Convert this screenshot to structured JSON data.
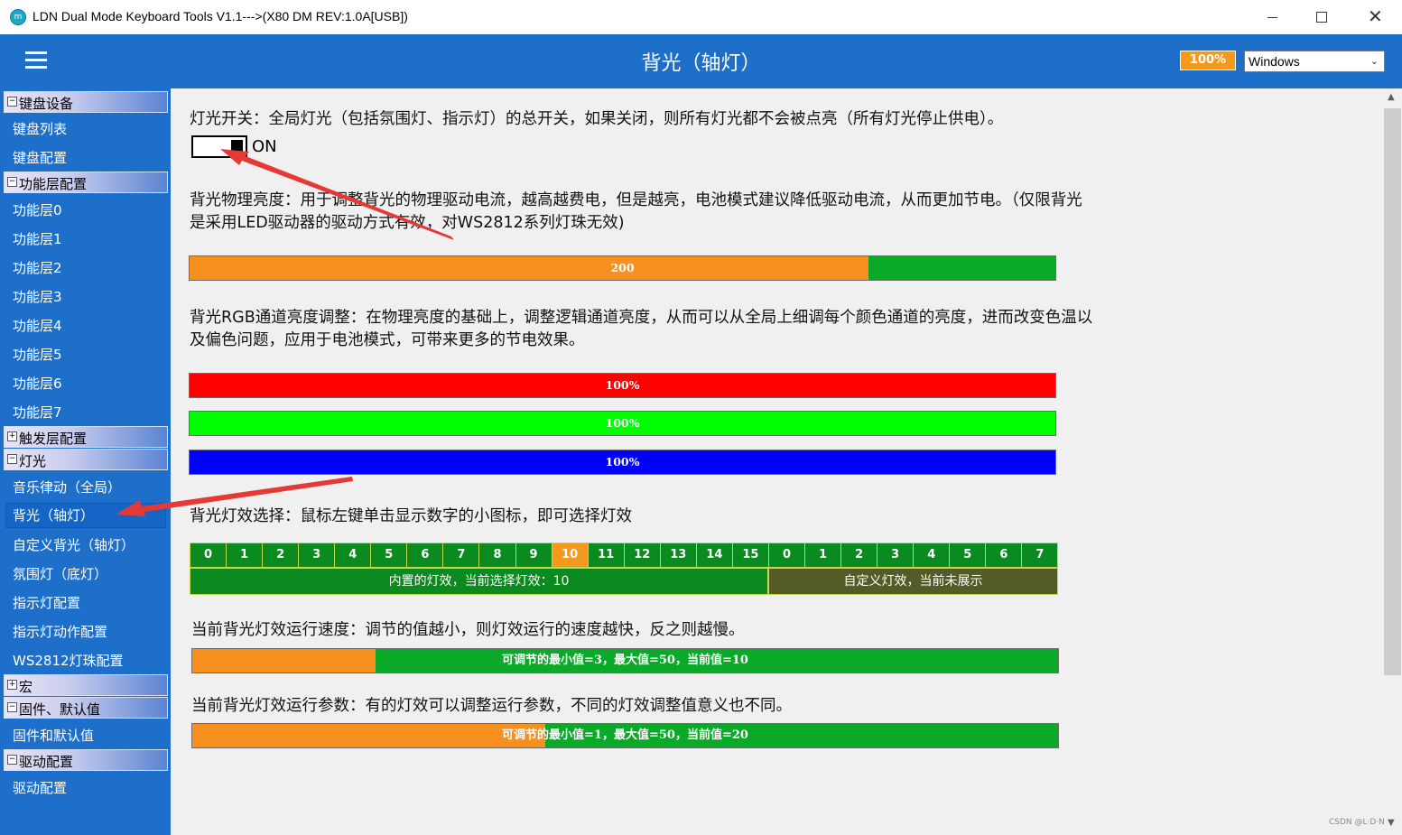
{
  "window": {
    "icon_text": "m",
    "title": "LDN Dual Mode Keyboard Tools V1.1--->(X80 DM REV:1.0A[USB])",
    "close_glyph": "✕"
  },
  "header": {
    "title": "背光（轴灯）",
    "zoom": "100%",
    "os_selected": "Windows",
    "chevron": "⌄"
  },
  "sidebar": {
    "groups": [
      {
        "label": "键盘设备",
        "toggle": "−"
      },
      {
        "label": "功能层配置",
        "toggle": "−"
      },
      {
        "label": "触发层配置",
        "toggle": "+"
      },
      {
        "label": "灯光",
        "toggle": "−"
      },
      {
        "label": "宏",
        "toggle": "+"
      },
      {
        "label": "固件、默认值",
        "toggle": "−"
      },
      {
        "label": "驱动配置",
        "toggle": "−"
      }
    ],
    "items": [
      "键盘列表",
      "键盘配置",
      "功能层0",
      "功能层1",
      "功能层2",
      "功能层3",
      "功能层4",
      "功能层5",
      "功能层6",
      "功能层7",
      "音乐律动（全局）",
      "背光（轴灯）",
      "自定义背光（轴灯）",
      "氛围灯（底灯）",
      "指示灯配置",
      "指示灯动作配置",
      "WS2812灯珠配置",
      "固件和默认值",
      "驱动配置"
    ],
    "active_item": "背光（轴灯）"
  },
  "content": {
    "power_desc": "灯光开关：全局灯光（包括氛围灯、指示灯）的总开关，如果关闭，则所有灯光都不会被点亮（所有灯光停止供电）。",
    "power_state": "ON",
    "brightness_desc_1": "背光物理亮度：用于调整背光的物理驱动电流，越高越费电，但是越亮，电池模式建议降低驱动电流，从而更加节电。（仅限背光",
    "brightness_desc_2": "是采用LED驱动器的驱动方式有效，对WS2812系列灯珠无效)",
    "brightness_value": "200",
    "brightness_fraction": 0.784,
    "rgb_desc_1": "背光RGB通道亮度调整：在物理亮度的基础上，调整逻辑通道亮度，从而可以从全局上细调每个颜色通道的亮度，进而改变色温以",
    "rgb_desc_2": "及偏色问题，应用于电池模式，可带来更多的节电效果。",
    "rgb": [
      {
        "channel": "red",
        "label": "100%",
        "color": "#ff0000"
      },
      {
        "channel": "green",
        "label": "100%",
        "color": "#00ff00"
      },
      {
        "channel": "blue",
        "label": "100%",
        "color": "#0000ff"
      }
    ],
    "effect_desc": "背光灯效选择：鼠标左键单击显示数字的小图标，即可选择灯效",
    "builtin_effects": [
      "0",
      "1",
      "2",
      "3",
      "4",
      "5",
      "6",
      "7",
      "8",
      "9",
      "10",
      "11",
      "12",
      "13",
      "14",
      "15"
    ],
    "custom_effects": [
      "0",
      "1",
      "2",
      "3",
      "4",
      "5",
      "6",
      "7"
    ],
    "selected_effect": "10",
    "builtin_label": "内置的灯效，当前选择灯效：10",
    "custom_label": "自定义灯效，当前未展示",
    "speed_desc": "当前背光灯效运行速度：调节的值越小，则灯效运行的速度越快，反之则越慢。",
    "speed_label": "可调节的最小值=3，最大值=50，当前值=10",
    "speed_fraction": 0.212,
    "param_desc": "当前背光灯效运行参数：有的灯效可以调整运行参数，不同的灯效调整值意义也不同。",
    "param_label": "可调节的最小值=1，最大值=50，当前值=20",
    "param_fraction": 0.408
  },
  "colors": {
    "accent_blue": "#1e6fc9",
    "orange": "#f39a1e",
    "green": "#0aa928",
    "annotation_red": "#e53935"
  },
  "watermark": "CSDN @L·D·N"
}
